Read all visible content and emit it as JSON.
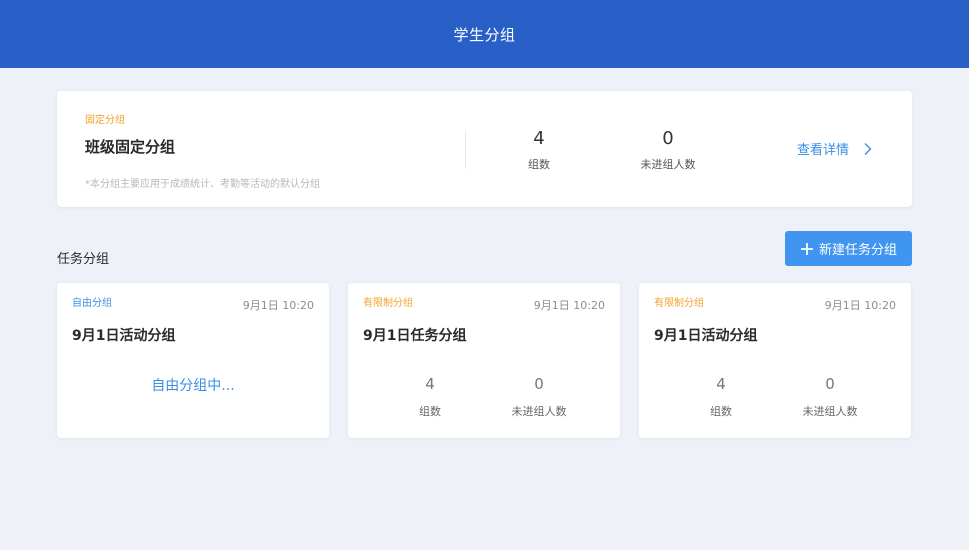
{
  "header": {
    "title": "学生分组"
  },
  "fixed_group": {
    "tag": "固定分组",
    "title": "班级固定分组",
    "note": "*本分组主要应用于成绩统计、考勤等活动的默认分组",
    "stats": [
      {
        "value": "4",
        "label": "组数"
      },
      {
        "value": "0",
        "label": "未进组人数"
      }
    ],
    "detail_link": "查看详情",
    "accent_color": "#f5a02b"
  },
  "task_section": {
    "title": "任务分组",
    "new_button": "新建任务分组"
  },
  "task_cards": [
    {
      "tag": "自由分组",
      "time": "9月1日  10:20",
      "title": "9月1日活动分组",
      "status": "自由分组中..."
    },
    {
      "tag": "有限制分组",
      "time": "9月1日  10:20",
      "title": "9月1日任务分组",
      "stats": [
        {
          "value": "4",
          "label": "组数"
        },
        {
          "value": "0",
          "label": "未进组人数"
        }
      ]
    },
    {
      "tag": "有限制分组",
      "time": "9月1日  10:20",
      "title": "9月1日活动分组",
      "stats": [
        {
          "value": "4",
          "label": "组数"
        },
        {
          "value": "0",
          "label": "未进组人数"
        }
      ]
    }
  ],
  "colors": {
    "header": "#2860c8",
    "primary": "#3f95f0",
    "link": "#3a8ee6",
    "warning_tag": "#f5a02b",
    "background": "#eef1f8"
  },
  "icons": {
    "detail": "chevron-right-icon",
    "new_button": "plus-icon"
  }
}
